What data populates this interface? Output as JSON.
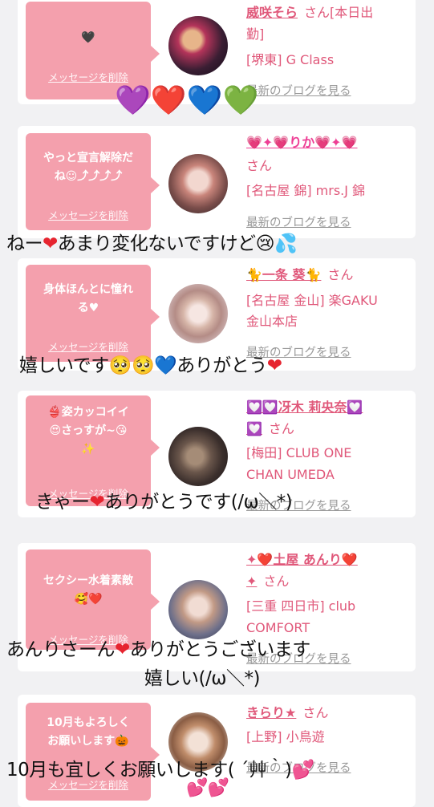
{
  "cards": [
    {
      "message": "🖤",
      "delete_label": "メッセージを削除",
      "avatar": "avatar-photo-dark",
      "name_line1": "威咲そら",
      "san": "さん",
      "name_suffix": "[本日出",
      "name_line2": "勤]",
      "shop": "[堺東] G Class",
      "blog": "最新のブログを見る"
    },
    {
      "message_line1": "やっと宣言解除だ",
      "message_line2": "ね☺⤴⤴⤴⤴",
      "delete_label": "メッセージを削除",
      "name_icons": "💗✦💗りか💗✦💗",
      "san": "さん",
      "shop": "[名古屋 錦] mrs.J 錦",
      "blog": "最新のブログを見る"
    },
    {
      "message_line1": "身体ほんとに憧れ",
      "message_line2": "る♥",
      "delete_label": "メッセージを削除",
      "name": "🐈一条 葵🐈",
      "san": "さん",
      "shop_line1": "[名古屋 金山] 楽GAKU",
      "shop_line2": "金山本店",
      "blog": "最新のブログを見る"
    },
    {
      "message_line1": "👙姿カッコイイ",
      "message_line2": "😍さっすが~😘",
      "message_line3": "✨",
      "delete_label": "メッセージを削除",
      "name": "💟💟冴木 莉央奈💟",
      "name_line2": "💟",
      "san": "さん",
      "shop_line1": "[梅田] CLUB ONE",
      "shop_line2": "CHAN UMEDA",
      "blog": "最新のブログを見る"
    },
    {
      "message_line1": "セクシー水着素敵",
      "message_line2": "🥰❤️",
      "delete_label": "メッセージを削除",
      "name": "✦❤️土屋 あんり❤️",
      "name_line2": "✦",
      "san": "さん",
      "shop_line1": "[三重 四日市] club",
      "shop_line2": "COMFORT",
      "blog": "最新のブログを見る"
    },
    {
      "message_line1": "10月もよろしく",
      "message_line2": "お願いします🎃",
      "delete_label": "メッセージを削除",
      "name": "きらり★",
      "san": "さん",
      "shop": "[上野] 小鳥遊",
      "blog": "最新のブログを見る"
    }
  ],
  "overlays": {
    "hearts_row": "💜❤️💙💚",
    "o1_text": "ねー",
    "o1_text2": "あまり変化ないですけど",
    "o2_text": "嬉しいです",
    "o2_text2": "ありがとう",
    "o3_text": "きゃー",
    "o3_text2": "ありがとうです(/ω＼*)",
    "o4_text": "あんりさーん",
    "o4_text2": "ありがとうございます",
    "o4_line2": "嬉しい(/ω＼*)",
    "o5_text": "10月も宜しくお願いします( ´艸｀)",
    "o5_tail": "💕💕"
  },
  "colors": {
    "accent": "#e0587a",
    "bubble": "#f4a0ad",
    "background": "#f1f1f3"
  }
}
